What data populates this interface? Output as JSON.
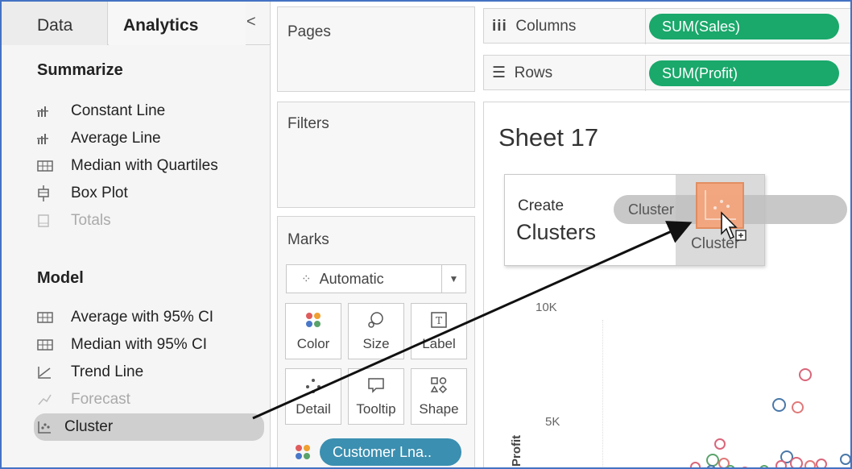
{
  "tabs": {
    "data": "Data",
    "analytics": "Analytics",
    "collapse": "<"
  },
  "summarize": {
    "title": "Summarize",
    "items": [
      {
        "label": "Constant Line",
        "icon": "constant-line-icon"
      },
      {
        "label": "Average Line",
        "icon": "average-line-icon"
      },
      {
        "label": "Median with Quartiles",
        "icon": "median-quartiles-icon"
      },
      {
        "label": "Box Plot",
        "icon": "box-plot-icon"
      },
      {
        "label": "Totals",
        "icon": "totals-icon"
      }
    ]
  },
  "model": {
    "title": "Model",
    "items": [
      {
        "label": "Average with 95% CI",
        "icon": "average-ci-icon"
      },
      {
        "label": "Median with 95% CI",
        "icon": "median-ci-icon"
      },
      {
        "label": "Trend Line",
        "icon": "trend-line-icon"
      },
      {
        "label": "Forecast",
        "icon": "forecast-icon"
      },
      {
        "label": "Cluster",
        "icon": "cluster-icon"
      }
    ]
  },
  "shelves": {
    "pages": "Pages",
    "filters": "Filters",
    "marks": "Marks"
  },
  "marks": {
    "type": "Automatic",
    "buttons": [
      "Color",
      "Size",
      "Label",
      "Detail",
      "Tooltip",
      "Shape"
    ],
    "field_pill": "Customer Lna.."
  },
  "columns": {
    "label": "Columns",
    "pill": "SUM(Sales)"
  },
  "rows": {
    "label": "Rows",
    "pill": "SUM(Profit)"
  },
  "sheet": {
    "title": "Sheet 17",
    "y_ticks": [
      "10K",
      "5K"
    ],
    "y_axis": "Profit"
  },
  "overlay": {
    "create": "Create",
    "clusters": "Clusters",
    "drag_pill": "Cluster",
    "drop_label": "Cluster"
  },
  "colors": {
    "green_pill": "#1aa86b",
    "blue_pill": "#3b8fb0",
    "cluster_orange": "#f4a57c",
    "circle_pink": "#d9667a",
    "circle_blue": "#4a78a8",
    "circle_green": "#5aa36b",
    "frame": "#4472c4"
  }
}
